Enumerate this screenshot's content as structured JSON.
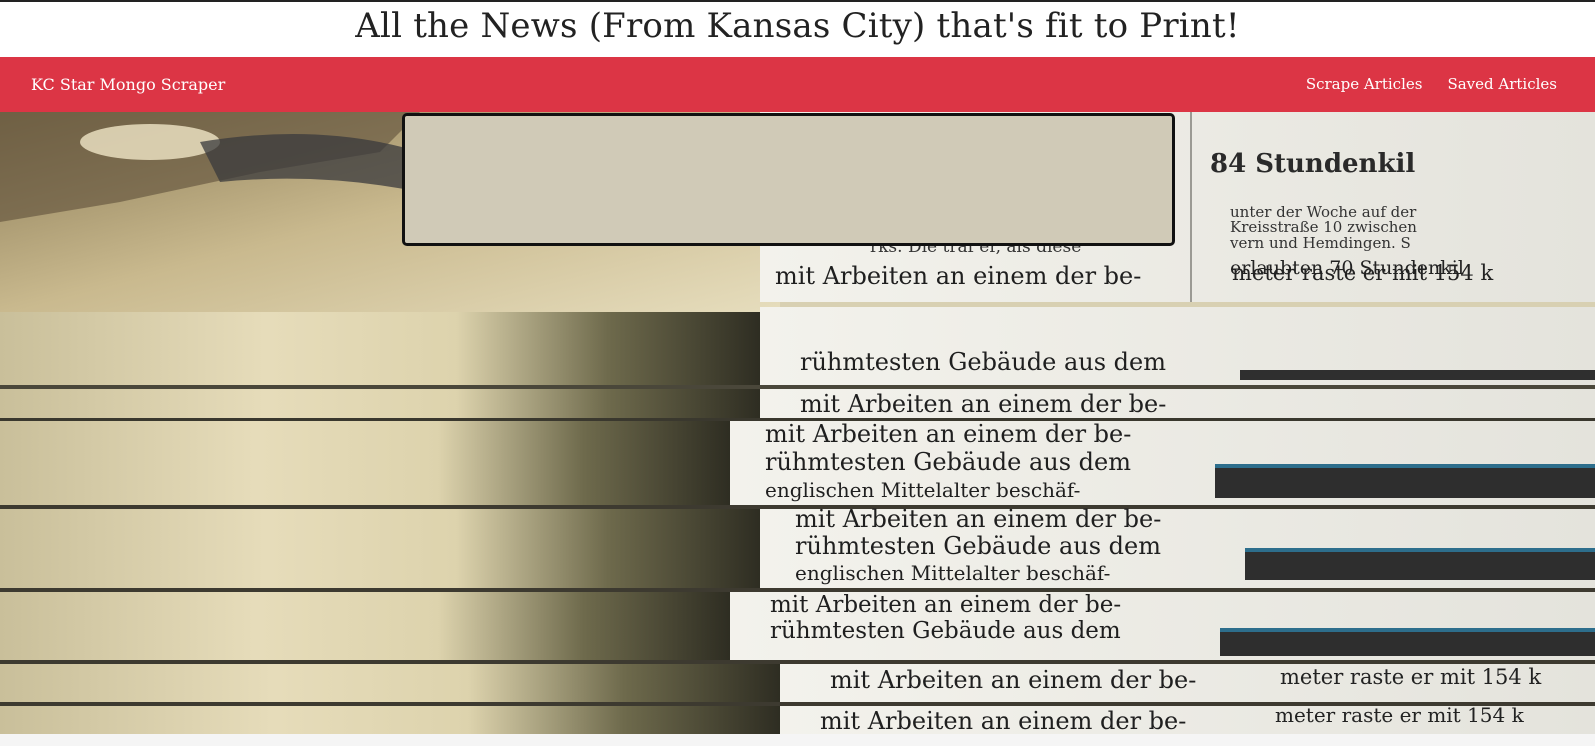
{
  "page": {
    "headline": "All the News (From Kansas City) that's fit to Print!"
  },
  "navbar": {
    "brand": "KC Star Mongo Scraper",
    "links": [
      {
        "label": "Scrape Articles"
      },
      {
        "label": "Saved Articles"
      }
    ]
  },
  "colors": {
    "navbar": "#dc3545",
    "article_box": "#d0cab7"
  },
  "hero": {
    "description_icon": "newspaper-stack-image",
    "paper_text": {
      "top_header": "84 Stundenkil",
      "lines": [
        "mit Arbeiten an einem der be-",
        "rühmtesten Gebäude aus dem",
        "englischen Mittelalter beschäf-",
        "meter raste er mit 154 k",
        "erlaubten 70 Stundenkil",
        "vern und Hemdingen. S",
        "Kreisstraße 10 zwischen",
        "unter der Woche auf der",
        "rks. Die traf er, als diese"
      ]
    }
  }
}
